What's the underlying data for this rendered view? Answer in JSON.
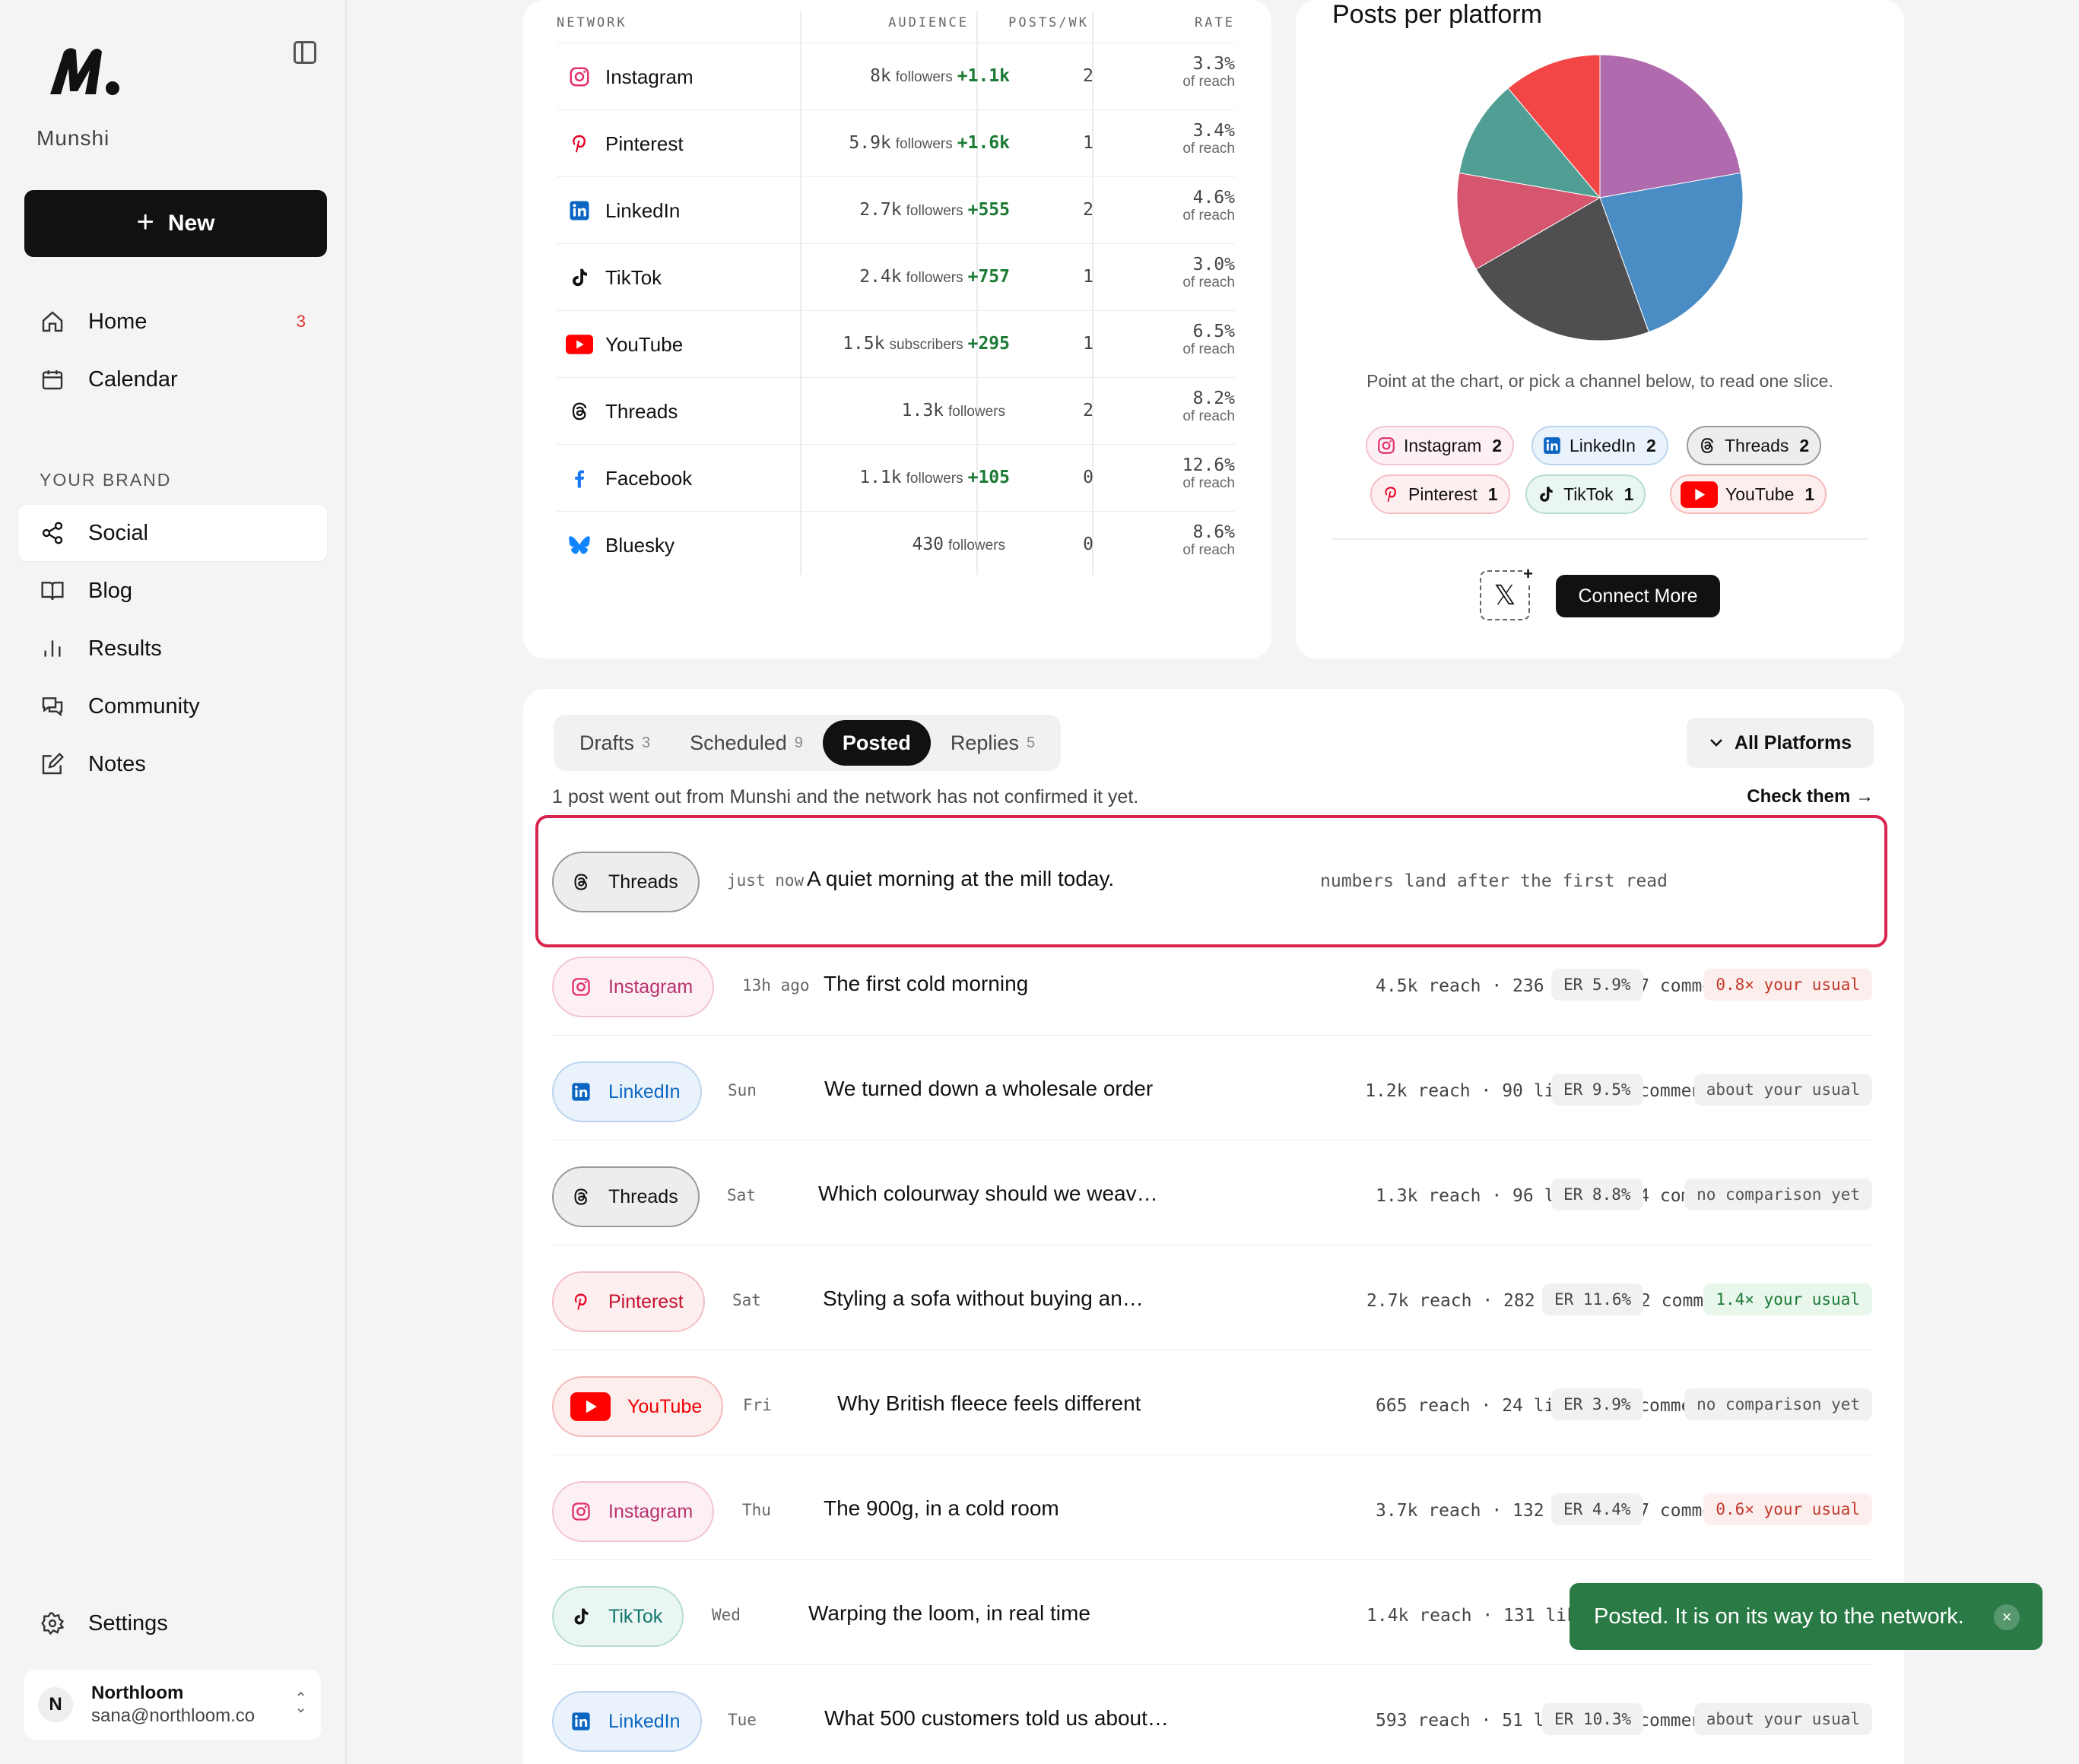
{
  "sidebar": {
    "brand": "Munshi",
    "new_label": "New",
    "nav": [
      {
        "label": "Home",
        "icon": "home-icon",
        "badge": "3"
      },
      {
        "label": "Calendar",
        "icon": "calendar-icon"
      }
    ],
    "section_label": "YOUR BRAND",
    "brand_nav": [
      {
        "label": "Social",
        "icon": "share-icon",
        "active": true
      },
      {
        "label": "Blog",
        "icon": "book-icon"
      },
      {
        "label": "Results",
        "icon": "bar-chart-icon"
      },
      {
        "label": "Community",
        "icon": "chat-icon"
      },
      {
        "label": "Notes",
        "icon": "edit-icon"
      }
    ],
    "settings_label": "Settings",
    "account": {
      "initial": "N",
      "name": "Northloom",
      "email": "sana@northloom.co"
    }
  },
  "networks": {
    "headers": {
      "network": "NETWORK",
      "audience": "AUDIENCE",
      "posts": "POSTS/WK",
      "rate": "RATE"
    },
    "rows": [
      {
        "name": "Instagram",
        "aud": "8k",
        "unit": "followers",
        "gain": "+1.1k",
        "posts": "2",
        "rate": "3.3%",
        "rate_sub": "of reach"
      },
      {
        "name": "Pinterest",
        "aud": "5.9k",
        "unit": "followers",
        "gain": "+1.6k",
        "posts": "1",
        "rate": "3.4%",
        "rate_sub": "of reach"
      },
      {
        "name": "LinkedIn",
        "aud": "2.7k",
        "unit": "followers",
        "gain": "+555",
        "posts": "2",
        "rate": "4.6%",
        "rate_sub": "of reach"
      },
      {
        "name": "TikTok",
        "aud": "2.4k",
        "unit": "followers",
        "gain": "+757",
        "posts": "1",
        "rate": "3.0%",
        "rate_sub": "of reach"
      },
      {
        "name": "YouTube",
        "aud": "1.5k",
        "unit": "subscribers",
        "gain": "+295",
        "posts": "1",
        "rate": "6.5%",
        "rate_sub": "of reach"
      },
      {
        "name": "Threads",
        "aud": "1.3k",
        "unit": "followers",
        "gain": "",
        "posts": "2",
        "rate": "8.2%",
        "rate_sub": "of reach"
      },
      {
        "name": "Facebook",
        "aud": "1.1k",
        "unit": "followers",
        "gain": "+105",
        "posts": "0",
        "rate": "12.6%",
        "rate_sub": "of reach"
      },
      {
        "name": "Bluesky",
        "aud": "430",
        "unit": "followers",
        "gain": "",
        "posts": "0",
        "rate": "8.6%",
        "rate_sub": "of reach"
      }
    ]
  },
  "pie": {
    "title": "Posts per platform",
    "hint": "Point at the chart, or pick a channel below, to read one slice.",
    "chips": [
      {
        "name": "Instagram",
        "count": "2"
      },
      {
        "name": "LinkedIn",
        "count": "2"
      },
      {
        "name": "Threads",
        "count": "2"
      },
      {
        "name": "Pinterest",
        "count": "1"
      },
      {
        "name": "TikTok",
        "count": "1"
      },
      {
        "name": "YouTube",
        "count": "1"
      }
    ],
    "x_label": "𝕏",
    "connect_label": "Connect More"
  },
  "chart_data": {
    "type": "pie",
    "categories": [
      "Instagram",
      "LinkedIn",
      "Threads",
      "Pinterest",
      "TikTok",
      "YouTube"
    ],
    "values": [
      2,
      2,
      2,
      1,
      1,
      1
    ],
    "colors": [
      "#b06aae",
      "#4a8cc4",
      "#4f4f52",
      "#d65670",
      "#519e95",
      "#f24545"
    ]
  },
  "posts": {
    "tabs": [
      {
        "label": "Drafts",
        "count": "3"
      },
      {
        "label": "Scheduled",
        "count": "9"
      },
      {
        "label": "Posted",
        "count": "",
        "active": true
      },
      {
        "label": "Replies",
        "count": "5"
      }
    ],
    "filter_label": "All Platforms",
    "notice": "1 post went out from Munshi and the network has not confirmed it yet.",
    "check_label": "Check them →",
    "rows": [
      {
        "platform": "Threads",
        "when": "just now",
        "title": "A quiet morning at the mill today.",
        "note": "numbers land after the first read"
      },
      {
        "platform": "Instagram",
        "when": "13h ago",
        "title": "The first cold morning",
        "stats": "4.5k reach · 236 likes · 7 comme…",
        "er": "ER 5.9%",
        "cmp": "0.8× your usual",
        "cmp_type": "bad"
      },
      {
        "platform": "LinkedIn",
        "when": "Sun",
        "title": "We turned down a wholesale order",
        "stats": "1.2k reach · 90 likes · 4 comments",
        "er": "ER 9.5%",
        "cmp": "about your usual",
        "cmp_type": "neutral"
      },
      {
        "platform": "Threads",
        "when": "Sat",
        "title": "Which colourway should we weav…",
        "stats": "1.3k reach · 96 likes · 14 comme…",
        "er": "ER 8.8%",
        "cmp": "no comparison yet",
        "cmp_type": "neutral"
      },
      {
        "platform": "Pinterest",
        "when": "Sat",
        "title": "Styling a sofa without buying an…",
        "stats": "2.7k reach · 282 likes · 22 comm…",
        "er": "ER 11.6%",
        "cmp": "1.4× your usual",
        "cmp_type": "good"
      },
      {
        "platform": "YouTube",
        "when": "Fri",
        "title": "Why British fleece feels different",
        "stats": "665 reach · 24 likes · 1 comments",
        "er": "ER 3.9%",
        "cmp": "no comparison yet",
        "cmp_type": "neutral"
      },
      {
        "platform": "Instagram",
        "when": "Thu",
        "title": "The 900g, in a cold room",
        "stats": "3.7k reach · 132 likes · 7 comme…",
        "er": "ER 4.4%",
        "cmp": "0.6× your usual",
        "cmp_type": "bad"
      },
      {
        "platform": "TikTok",
        "when": "Wed",
        "title": "Warping the loom, in real time",
        "stats": "1.4k reach · 131 likes · 7 comme…",
        "er": "",
        "cmp": "",
        "cmp_type": ""
      },
      {
        "platform": "LinkedIn",
        "when": "Tue",
        "title": "What 500 customers told us about…",
        "stats": "593 reach · 51 likes · 4 comments",
        "er": "ER 10.3%",
        "cmp": "about your usual",
        "cmp_type": "neutral"
      }
    ]
  },
  "toast": {
    "message": "Posted. It is on its way to the network.",
    "close": "×"
  }
}
